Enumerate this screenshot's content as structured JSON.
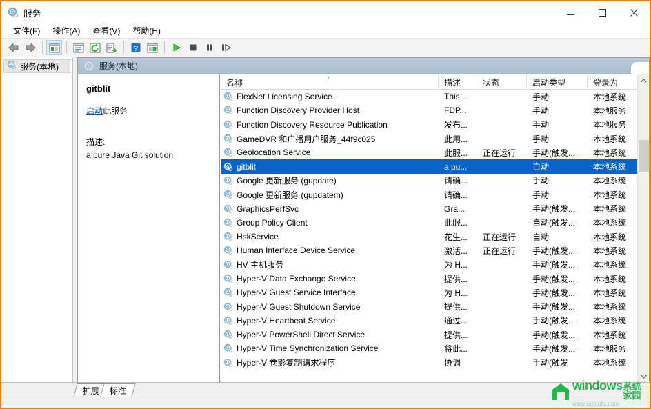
{
  "window": {
    "title": "服务",
    "icon": "services-gear-icon",
    "controls": {
      "minimize": "minimize-icon",
      "maximize": "maximize-icon",
      "close": "close-icon"
    },
    "border_color": "#e0801a"
  },
  "menubar": {
    "items": [
      {
        "label": "文件(F)",
        "name": "menu-file"
      },
      {
        "label": "操作(A)",
        "name": "menu-action"
      },
      {
        "label": "查看(V)",
        "name": "menu-view"
      },
      {
        "label": "帮助(H)",
        "name": "menu-help"
      }
    ]
  },
  "toolbar": {
    "buttons": [
      {
        "name": "back-icon",
        "glyph": "back"
      },
      {
        "name": "forward-icon",
        "glyph": "forward"
      },
      {
        "name": "show-hide-tree-icon",
        "glyph": "panel",
        "pressed": true
      },
      {
        "name": "properties-icon",
        "glyph": "props"
      },
      {
        "name": "refresh-icon",
        "glyph": "refresh"
      },
      {
        "name": "export-list-icon",
        "glyph": "export"
      },
      {
        "name": "help-icon",
        "glyph": "help"
      },
      {
        "name": "show-action-pane-icon",
        "glyph": "actionpane"
      },
      {
        "name": "start-service-icon",
        "glyph": "play"
      },
      {
        "name": "stop-service-icon",
        "glyph": "stop"
      },
      {
        "name": "pause-service-icon",
        "glyph": "pause"
      },
      {
        "name": "restart-service-icon",
        "glyph": "restart"
      }
    ]
  },
  "tree": {
    "items": [
      {
        "label": "服务(本地)",
        "icon": "services-gear-icon",
        "name": "tree-item-services-local",
        "selected": true
      }
    ]
  },
  "pane": {
    "header": "服务(本地)"
  },
  "details": {
    "service_name": "gitblit",
    "action_link": "启动",
    "action_suffix": "此服务",
    "description_label": "描述:",
    "description_text": "a pure Java Git solution"
  },
  "list": {
    "columns": [
      {
        "key": "name",
        "label": "名称",
        "sorted": true
      },
      {
        "key": "desc",
        "label": "描述"
      },
      {
        "key": "status",
        "label": "状态"
      },
      {
        "key": "startup",
        "label": "启动类型"
      },
      {
        "key": "logon",
        "label": "登录为"
      }
    ],
    "rows": [
      {
        "name": "FlexNet Licensing Service",
        "desc": "This ...",
        "status": "",
        "startup": "手动",
        "logon": "本地系统",
        "selected": false
      },
      {
        "name": "Function Discovery Provider Host",
        "desc": "FDP...",
        "status": "",
        "startup": "手动",
        "logon": "本地服务",
        "selected": false
      },
      {
        "name": "Function Discovery Resource Publication",
        "desc": "发布...",
        "status": "",
        "startup": "手动",
        "logon": "本地服务",
        "selected": false
      },
      {
        "name": "GameDVR 和广播用户服务_44f9c025",
        "desc": "此用...",
        "status": "",
        "startup": "手动",
        "logon": "本地系统",
        "selected": false
      },
      {
        "name": "Geolocation Service",
        "desc": "此服...",
        "status": "正在运行",
        "startup": "手动(触发...",
        "logon": "本地系统",
        "selected": false
      },
      {
        "name": "gitblit",
        "desc": "a pu...",
        "status": "",
        "startup": "自动",
        "logon": "本地系统",
        "selected": true
      },
      {
        "name": "Google 更新服务 (gupdate)",
        "desc": "请确...",
        "status": "",
        "startup": "手动",
        "logon": "本地系统",
        "selected": false
      },
      {
        "name": "Google 更新服务 (gupdatem)",
        "desc": "请确...",
        "status": "",
        "startup": "手动",
        "logon": "本地系统",
        "selected": false
      },
      {
        "name": "GraphicsPerfSvc",
        "desc": "Gra...",
        "status": "",
        "startup": "手动(触发...",
        "logon": "本地系统",
        "selected": false
      },
      {
        "name": "Group Policy Client",
        "desc": "此服...",
        "status": "",
        "startup": "自动(触发...",
        "logon": "本地系统",
        "selected": false
      },
      {
        "name": "HskService",
        "desc": "花生...",
        "status": "正在运行",
        "startup": "自动",
        "logon": "本地系统",
        "selected": false
      },
      {
        "name": "Human Interface Device Service",
        "desc": "激活...",
        "status": "正在运行",
        "startup": "手动(触发...",
        "logon": "本地系统",
        "selected": false
      },
      {
        "name": "HV 主机服务",
        "desc": "为 H...",
        "status": "",
        "startup": "手动(触发...",
        "logon": "本地系统",
        "selected": false
      },
      {
        "name": "Hyper-V Data Exchange Service",
        "desc": "提供...",
        "status": "",
        "startup": "手动(触发...",
        "logon": "本地系统",
        "selected": false
      },
      {
        "name": "Hyper-V Guest Service Interface",
        "desc": "为 H...",
        "status": "",
        "startup": "手动(触发...",
        "logon": "本地系统",
        "selected": false
      },
      {
        "name": "Hyper-V Guest Shutdown Service",
        "desc": "提供...",
        "status": "",
        "startup": "手动(触发...",
        "logon": "本地系统",
        "selected": false
      },
      {
        "name": "Hyper-V Heartbeat Service",
        "desc": "通过...",
        "status": "",
        "startup": "手动(触发...",
        "logon": "本地系统",
        "selected": false
      },
      {
        "name": "Hyper-V PowerShell Direct Service",
        "desc": "提供...",
        "status": "",
        "startup": "手动(触发...",
        "logon": "本地系统",
        "selected": false
      },
      {
        "name": "Hyper-V Time Synchronization Service",
        "desc": "将此...",
        "status": "",
        "startup": "手动(触发...",
        "logon": "本地服务",
        "selected": false
      },
      {
        "name": "Hyper-V 卷影复制请求程序",
        "desc": "协调",
        "status": "",
        "startup": "手动(触发",
        "logon": "本地系统",
        "selected": false
      }
    ],
    "selection_color": "#0a64c8"
  },
  "tabs": {
    "items": [
      {
        "label": "扩展",
        "name": "tab-extended",
        "active": false
      },
      {
        "label": "标准",
        "name": "tab-standard",
        "active": true
      }
    ]
  },
  "watermark": {
    "brand": "windows",
    "brand_cn": "系统家园",
    "url": "www.ruihaifu.com",
    "color": "#2bb24c"
  }
}
